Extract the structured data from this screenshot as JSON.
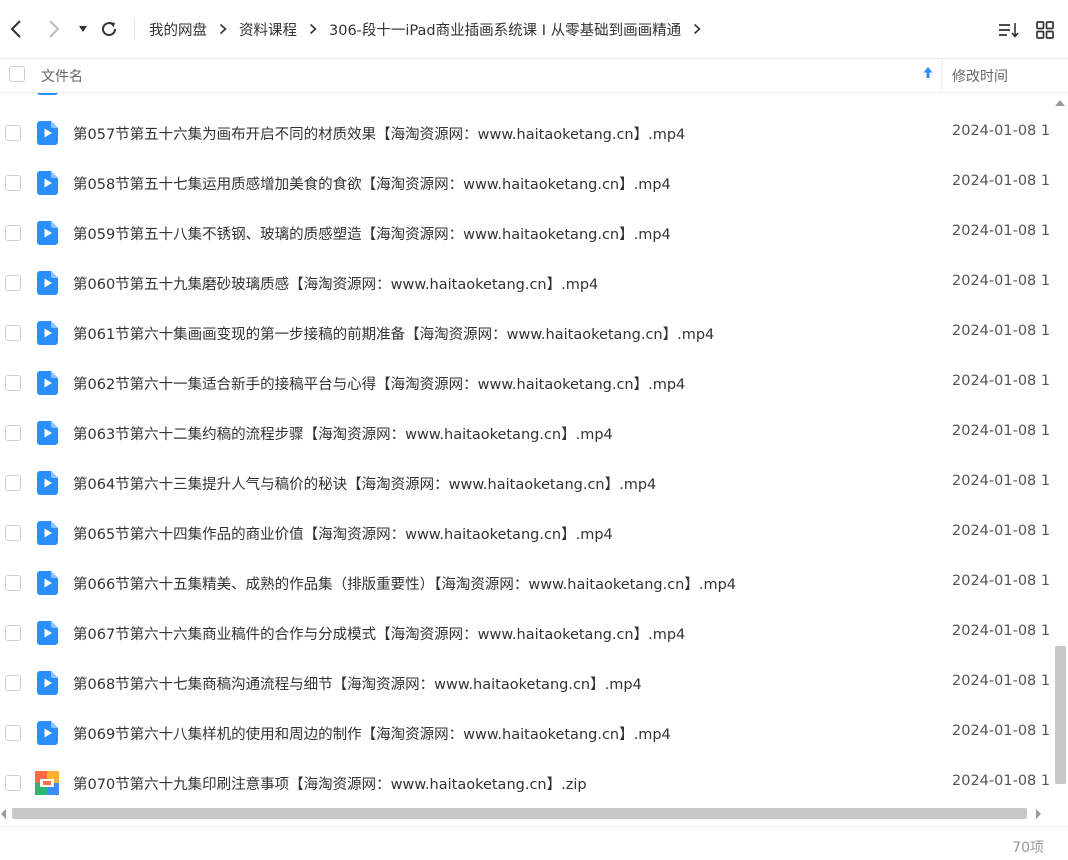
{
  "breadcrumb": [
    "我的网盘",
    "资料课程",
    "306-段十一iPad商业插画系统课 I 从零基础到画画精通"
  ],
  "header": {
    "name_label": "文件名",
    "time_label": "修改时间"
  },
  "files": [
    {
      "name": "第057节第五十六集为画布开启不同的材质效果【海淘资源网：www.haitaoketang.cn】.mp4",
      "time": "2024-01-08 1",
      "type": "video"
    },
    {
      "name": "第058节第五十七集运用质感增加美食的食欲【海淘资源网：www.haitaoketang.cn】.mp4",
      "time": "2024-01-08 1",
      "type": "video"
    },
    {
      "name": "第059节第五十八集不锈钢、玻璃的质感塑造【海淘资源网：www.haitaoketang.cn】.mp4",
      "time": "2024-01-08 1",
      "type": "video"
    },
    {
      "name": "第060节第五十九集磨砂玻璃质感【海淘资源网：www.haitaoketang.cn】.mp4",
      "time": "2024-01-08 1",
      "type": "video"
    },
    {
      "name": "第061节第六十集画画变现的第一步接稿的前期准备【海淘资源网：www.haitaoketang.cn】.mp4",
      "time": "2024-01-08 1",
      "type": "video"
    },
    {
      "name": "第062节第六十一集适合新手的接稿平台与心得【海淘资源网：www.haitaoketang.cn】.mp4",
      "time": "2024-01-08 1",
      "type": "video"
    },
    {
      "name": "第063节第六十二集约稿的流程步骤【海淘资源网：www.haitaoketang.cn】.mp4",
      "time": "2024-01-08 1",
      "type": "video"
    },
    {
      "name": "第064节第六十三集提升人气与稿价的秘诀【海淘资源网：www.haitaoketang.cn】.mp4",
      "time": "2024-01-08 1",
      "type": "video"
    },
    {
      "name": "第065节第六十四集作品的商业价值【海淘资源网：www.haitaoketang.cn】.mp4",
      "time": "2024-01-08 1",
      "type": "video"
    },
    {
      "name": "第066节第六十五集精美、成熟的作品集（排版重要性）【海淘资源网：www.haitaoketang.cn】.mp4",
      "time": "2024-01-08 1",
      "type": "video"
    },
    {
      "name": "第067节第六十六集商业稿件的合作与分成模式【海淘资源网：www.haitaoketang.cn】.mp4",
      "time": "2024-01-08 1",
      "type": "video"
    },
    {
      "name": "第068节第六十七集商稿沟通流程与细节【海淘资源网：www.haitaoketang.cn】.mp4",
      "time": "2024-01-08 1",
      "type": "video"
    },
    {
      "name": "第069节第六十八集样机的使用和周边的制作【海淘资源网：www.haitaoketang.cn】.mp4",
      "time": "2024-01-08 1",
      "type": "video"
    },
    {
      "name": "第070节第六十九集印刷注意事项【海淘资源网：www.haitaoketang.cn】.zip",
      "time": "2024-01-08 1",
      "type": "zip"
    }
  ],
  "status": {
    "count": "70项"
  },
  "colors": {
    "video_icon": "#2b8eff",
    "text": "#333333",
    "scrollbar": "#c8c8c8"
  },
  "icons": [
    "back-icon",
    "forward-icon",
    "dropdown-icon",
    "refresh-icon",
    "chevron-right-icon",
    "sort-icon",
    "grid-view-icon",
    "sort-up-arrow-icon",
    "video-file-icon",
    "zip-file-icon"
  ]
}
